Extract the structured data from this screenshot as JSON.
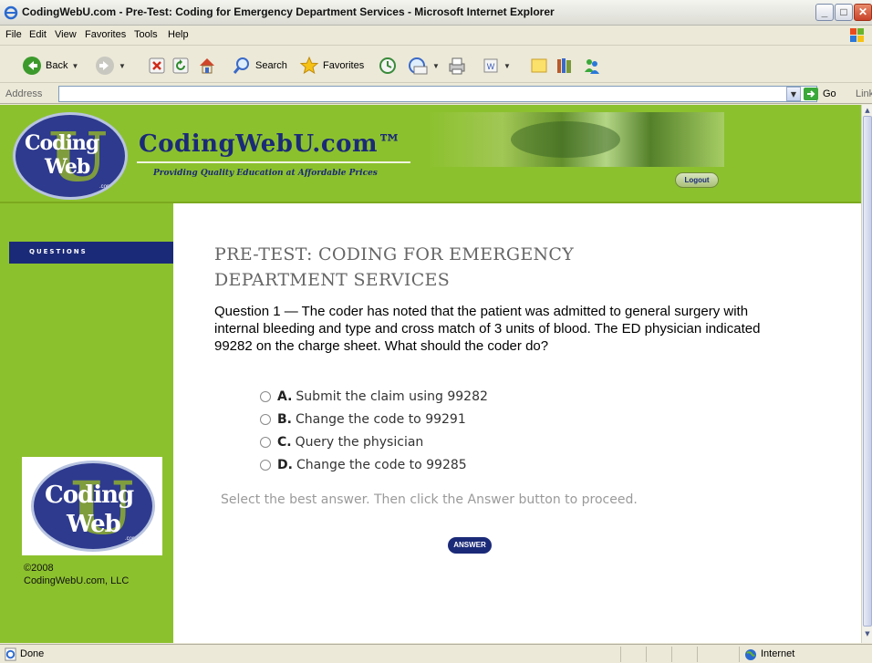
{
  "window": {
    "title": "CodingWebU.com - Pre-Test: Coding for Emergency Department Services - Microsoft Internet Explorer",
    "min": "_",
    "max": "□",
    "close": "✕"
  },
  "menu": [
    "File",
    "Edit",
    "View",
    "Favorites",
    "Tools",
    "Help"
  ],
  "toolbar": {
    "back": "Back",
    "search": "Search",
    "favorites": "Favorites"
  },
  "address": {
    "label": "Address",
    "value": "",
    "go": "Go",
    "links": "Links"
  },
  "header": {
    "logo_word1": "Coding",
    "logo_word2": "Web",
    "logo_com": ".com",
    "brand": "CodingWebU.com™",
    "tagline": "Providing Quality Education at Affordable Prices",
    "logout": "Logout"
  },
  "sidebar": {
    "tab": "QUESTIONS",
    "copyright_line1": "©2008",
    "copyright_line2": "CodingWebU.com, LLC"
  },
  "main": {
    "title": "PRE-TEST: CODING FOR EMERGENCY DEPARTMENT SERVICES",
    "question": "Question 1 — The coder has noted that the patient was admitted to general surgery with internal bleeding and type and cross match of 3 units of blood. The ED physician indicated 99282 on the charge sheet. What should the coder do?",
    "options": [
      {
        "letter": "A.",
        "text": "Submit the claim using 99282"
      },
      {
        "letter": "B.",
        "text": "Change the code to 99291"
      },
      {
        "letter": "C.",
        "text": "Query the physician"
      },
      {
        "letter": "D.",
        "text": "Change the code to 99285"
      }
    ],
    "instruction": "Select the best answer. Then click the Answer button to proceed.",
    "answer_button": "ANSWER"
  },
  "status": {
    "text": "Done",
    "zone": "Internet"
  },
  "colors": {
    "page_green": "#8cc12e",
    "navy": "#1b2a78"
  }
}
